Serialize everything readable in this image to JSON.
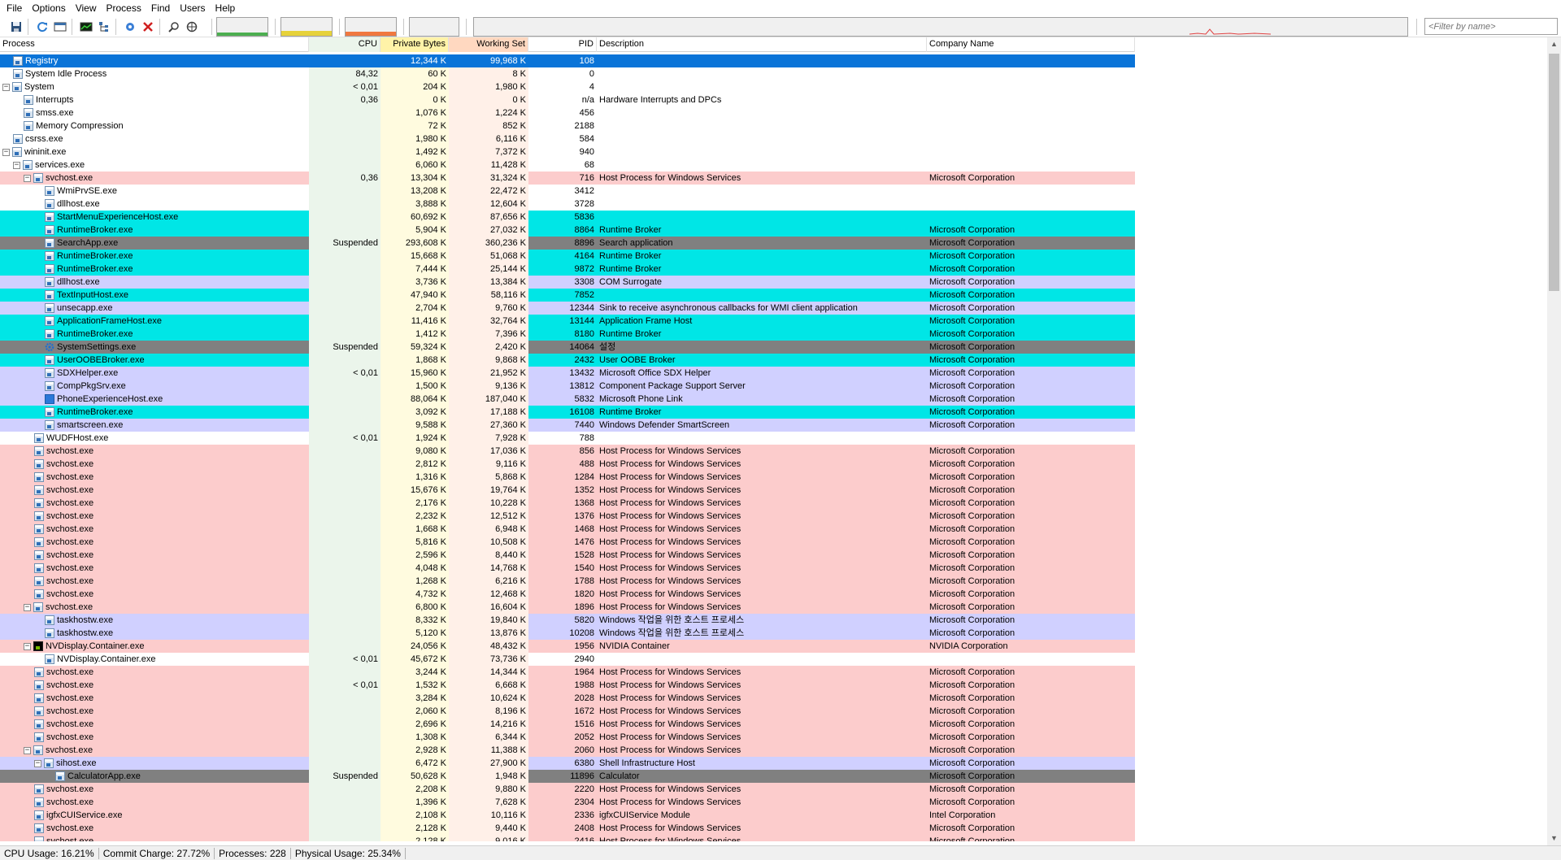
{
  "menu": [
    "File",
    "Options",
    "View",
    "Process",
    "Find",
    "Users",
    "Help"
  ],
  "toolbar": {
    "filter_placeholder": "<Filter by name>",
    "icons": [
      "save-icon",
      "refresh-icon",
      "window-icon",
      "sysinfo-icon",
      "tree-icon",
      "target-icon",
      "kill-icon",
      "find-icon",
      "crosshair-icon"
    ]
  },
  "columns": {
    "process": "Process",
    "cpu": "CPU",
    "private": "Private Bytes",
    "working": "Working Set",
    "pid": "PID",
    "description": "Description",
    "company": "Company Name"
  },
  "colors": {
    "selected": "#0a74d8",
    "services": "#fccccc",
    "own": "#d0d0ff",
    "immersive": "#00e6e6",
    "suspended": "#808080",
    "cpu_tint": "#ebf5eb",
    "private_tint": "#fffbdf",
    "working_tint": "#fff0e8"
  },
  "rows": [
    {
      "name": "Registry",
      "depth": 0,
      "toggle": "",
      "icon": "proc",
      "cpu": "",
      "priv": "12,344 K",
      "ws": "99,968 K",
      "pid": "108",
      "desc": "",
      "comp": "",
      "type": "selected"
    },
    {
      "name": "System Idle Process",
      "depth": 0,
      "toggle": "",
      "icon": "proc",
      "cpu": "84,32",
      "priv": "60 K",
      "ws": "8 K",
      "pid": "0",
      "desc": "",
      "comp": "",
      "type": "none"
    },
    {
      "name": "System",
      "depth": 0,
      "toggle": "-",
      "icon": "proc",
      "cpu": "< 0,01",
      "priv": "204 K",
      "ws": "1,980 K",
      "pid": "4",
      "desc": "",
      "comp": "",
      "type": "none"
    },
    {
      "name": "Interrupts",
      "depth": 1,
      "toggle": "",
      "icon": "proc",
      "cpu": "0,36",
      "priv": "0 K",
      "ws": "0 K",
      "pid": "n/a",
      "desc": "Hardware Interrupts and DPCs",
      "comp": "",
      "type": "none"
    },
    {
      "name": "smss.exe",
      "depth": 1,
      "toggle": "",
      "icon": "proc",
      "cpu": "",
      "priv": "1,076 K",
      "ws": "1,224 K",
      "pid": "456",
      "desc": "",
      "comp": "",
      "type": "none"
    },
    {
      "name": "Memory Compression",
      "depth": 1,
      "toggle": "",
      "icon": "proc",
      "cpu": "",
      "priv": "72 K",
      "ws": "852 K",
      "pid": "2188",
      "desc": "",
      "comp": "",
      "type": "none"
    },
    {
      "name": "csrss.exe",
      "depth": 0,
      "toggle": "",
      "icon": "proc",
      "cpu": "",
      "priv": "1,980 K",
      "ws": "6,116 K",
      "pid": "584",
      "desc": "",
      "comp": "",
      "type": "none"
    },
    {
      "name": "wininit.exe",
      "depth": 0,
      "toggle": "-",
      "icon": "proc",
      "cpu": "",
      "priv": "1,492 K",
      "ws": "7,372 K",
      "pid": "940",
      "desc": "",
      "comp": "",
      "type": "none"
    },
    {
      "name": "services.exe",
      "depth": 1,
      "toggle": "-",
      "icon": "proc",
      "cpu": "",
      "priv": "6,060 K",
      "ws": "11,428 K",
      "pid": "68",
      "desc": "",
      "comp": "",
      "type": "none"
    },
    {
      "name": "svchost.exe",
      "depth": 2,
      "toggle": "-",
      "icon": "proc",
      "cpu": "0,36",
      "priv": "13,304 K",
      "ws": "31,324 K",
      "pid": "716",
      "desc": "Host Process for Windows Services",
      "comp": "Microsoft Corporation",
      "type": "services"
    },
    {
      "name": "WmiPrvSE.exe",
      "depth": 3,
      "toggle": "",
      "icon": "proc",
      "cpu": "",
      "priv": "13,208 K",
      "ws": "22,472 K",
      "pid": "3412",
      "desc": "",
      "comp": "",
      "type": "none"
    },
    {
      "name": "dllhost.exe",
      "depth": 3,
      "toggle": "",
      "icon": "proc",
      "cpu": "",
      "priv": "3,888 K",
      "ws": "12,604 K",
      "pid": "3728",
      "desc": "",
      "comp": "",
      "type": "none"
    },
    {
      "name": "StartMenuExperienceHost.exe",
      "depth": 3,
      "toggle": "",
      "icon": "proc",
      "cpu": "",
      "priv": "60,692 K",
      "ws": "87,656 K",
      "pid": "5836",
      "desc": "",
      "comp": "",
      "type": "immersive"
    },
    {
      "name": "RuntimeBroker.exe",
      "depth": 3,
      "toggle": "",
      "icon": "proc",
      "cpu": "",
      "priv": "5,904 K",
      "ws": "27,032 K",
      "pid": "8864",
      "desc": "Runtime Broker",
      "comp": "Microsoft Corporation",
      "type": "immersive"
    },
    {
      "name": "SearchApp.exe",
      "depth": 3,
      "toggle": "",
      "icon": "proc",
      "cpu": "Suspended",
      "priv": "293,608 K",
      "ws": "360,236 K",
      "pid": "8896",
      "desc": "Search application",
      "comp": "Microsoft Corporation",
      "type": "suspended"
    },
    {
      "name": "RuntimeBroker.exe",
      "depth": 3,
      "toggle": "",
      "icon": "proc",
      "cpu": "",
      "priv": "15,668 K",
      "ws": "51,068 K",
      "pid": "4164",
      "desc": "Runtime Broker",
      "comp": "Microsoft Corporation",
      "type": "immersive"
    },
    {
      "name": "RuntimeBroker.exe",
      "depth": 3,
      "toggle": "",
      "icon": "proc",
      "cpu": "",
      "priv": "7,444 K",
      "ws": "25,144 K",
      "pid": "9872",
      "desc": "Runtime Broker",
      "comp": "Microsoft Corporation",
      "type": "immersive"
    },
    {
      "name": "dllhost.exe",
      "depth": 3,
      "toggle": "",
      "icon": "proc",
      "cpu": "",
      "priv": "3,736 K",
      "ws": "13,384 K",
      "pid": "3308",
      "desc": "COM Surrogate",
      "comp": "Microsoft Corporation",
      "type": "own"
    },
    {
      "name": "TextInputHost.exe",
      "depth": 3,
      "toggle": "",
      "icon": "proc",
      "cpu": "",
      "priv": "47,940 K",
      "ws": "58,116 K",
      "pid": "7852",
      "desc": "",
      "comp": "Microsoft Corporation",
      "type": "immersive"
    },
    {
      "name": "unsecapp.exe",
      "depth": 3,
      "toggle": "",
      "icon": "proc",
      "cpu": "",
      "priv": "2,704 K",
      "ws": "9,760 K",
      "pid": "12344",
      "desc": "Sink to receive asynchronous callbacks for WMI client application",
      "comp": "Microsoft Corporation",
      "type": "own"
    },
    {
      "name": "ApplicationFrameHost.exe",
      "depth": 3,
      "toggle": "",
      "icon": "proc",
      "cpu": "",
      "priv": "11,416 K",
      "ws": "32,764 K",
      "pid": "13144",
      "desc": "Application Frame Host",
      "comp": "Microsoft Corporation",
      "type": "immersive"
    },
    {
      "name": "RuntimeBroker.exe",
      "depth": 3,
      "toggle": "",
      "icon": "proc",
      "cpu": "",
      "priv": "1,412 K",
      "ws": "7,396 K",
      "pid": "8180",
      "desc": "Runtime Broker",
      "comp": "Microsoft Corporation",
      "type": "immersive"
    },
    {
      "name": "SystemSettings.exe",
      "depth": 3,
      "toggle": "",
      "icon": "gear",
      "cpu": "Suspended",
      "priv": "59,324 K",
      "ws": "2,420 K",
      "pid": "14064",
      "desc": "설정",
      "comp": "Microsoft Corporation",
      "type": "suspended"
    },
    {
      "name": "UserOOBEBroker.exe",
      "depth": 3,
      "toggle": "",
      "icon": "proc",
      "cpu": "",
      "priv": "1,868 K",
      "ws": "9,868 K",
      "pid": "2432",
      "desc": "User OOBE Broker",
      "comp": "Microsoft Corporation",
      "type": "immersive"
    },
    {
      "name": "SDXHelper.exe",
      "depth": 3,
      "toggle": "",
      "icon": "proc",
      "cpu": "< 0,01",
      "priv": "15,960 K",
      "ws": "21,952 K",
      "pid": "13432",
      "desc": "Microsoft Office SDX Helper",
      "comp": "Microsoft Corporation",
      "type": "own"
    },
    {
      "name": "CompPkgSrv.exe",
      "depth": 3,
      "toggle": "",
      "icon": "proc",
      "cpu": "",
      "priv": "1,500 K",
      "ws": "9,136 K",
      "pid": "13812",
      "desc": "Component Package Support Server",
      "comp": "Microsoft Corporation",
      "type": "own"
    },
    {
      "name": "PhoneExperienceHost.exe",
      "depth": 3,
      "toggle": "",
      "icon": "phone",
      "cpu": "",
      "priv": "88,064 K",
      "ws": "187,040 K",
      "pid": "5832",
      "desc": "Microsoft Phone Link",
      "comp": "Microsoft Corporation",
      "type": "own"
    },
    {
      "name": "RuntimeBroker.exe",
      "depth": 3,
      "toggle": "",
      "icon": "proc",
      "cpu": "",
      "priv": "3,092 K",
      "ws": "17,188 K",
      "pid": "16108",
      "desc": "Runtime Broker",
      "comp": "Microsoft Corporation",
      "type": "immersive"
    },
    {
      "name": "smartscreen.exe",
      "depth": 3,
      "toggle": "",
      "icon": "proc",
      "cpu": "",
      "priv": "9,588 K",
      "ws": "27,360 K",
      "pid": "7440",
      "desc": "Windows Defender SmartScreen",
      "comp": "Microsoft Corporation",
      "type": "own"
    },
    {
      "name": "WUDFHost.exe",
      "depth": 2,
      "toggle": "",
      "icon": "proc",
      "cpu": "< 0,01",
      "priv": "1,924 K",
      "ws": "7,928 K",
      "pid": "788",
      "desc": "",
      "comp": "",
      "type": "none"
    },
    {
      "name": "svchost.exe",
      "depth": 2,
      "toggle": "",
      "icon": "proc",
      "cpu": "",
      "priv": "9,080 K",
      "ws": "17,036 K",
      "pid": "856",
      "desc": "Host Process for Windows Services",
      "comp": "Microsoft Corporation",
      "type": "services"
    },
    {
      "name": "svchost.exe",
      "depth": 2,
      "toggle": "",
      "icon": "proc",
      "cpu": "",
      "priv": "2,812 K",
      "ws": "9,116 K",
      "pid": "488",
      "desc": "Host Process for Windows Services",
      "comp": "Microsoft Corporation",
      "type": "services"
    },
    {
      "name": "svchost.exe",
      "depth": 2,
      "toggle": "",
      "icon": "proc",
      "cpu": "",
      "priv": "1,316 K",
      "ws": "5,868 K",
      "pid": "1284",
      "desc": "Host Process for Windows Services",
      "comp": "Microsoft Corporation",
      "type": "services"
    },
    {
      "name": "svchost.exe",
      "depth": 2,
      "toggle": "",
      "icon": "proc",
      "cpu": "",
      "priv": "15,676 K",
      "ws": "19,764 K",
      "pid": "1352",
      "desc": "Host Process for Windows Services",
      "comp": "Microsoft Corporation",
      "type": "services"
    },
    {
      "name": "svchost.exe",
      "depth": 2,
      "toggle": "",
      "icon": "proc",
      "cpu": "",
      "priv": "2,176 K",
      "ws": "10,228 K",
      "pid": "1368",
      "desc": "Host Process for Windows Services",
      "comp": "Microsoft Corporation",
      "type": "services"
    },
    {
      "name": "svchost.exe",
      "depth": 2,
      "toggle": "",
      "icon": "proc",
      "cpu": "",
      "priv": "2,232 K",
      "ws": "12,512 K",
      "pid": "1376",
      "desc": "Host Process for Windows Services",
      "comp": "Microsoft Corporation",
      "type": "services"
    },
    {
      "name": "svchost.exe",
      "depth": 2,
      "toggle": "",
      "icon": "proc",
      "cpu": "",
      "priv": "1,668 K",
      "ws": "6,948 K",
      "pid": "1468",
      "desc": "Host Process for Windows Services",
      "comp": "Microsoft Corporation",
      "type": "services"
    },
    {
      "name": "svchost.exe",
      "depth": 2,
      "toggle": "",
      "icon": "proc",
      "cpu": "",
      "priv": "5,816 K",
      "ws": "10,508 K",
      "pid": "1476",
      "desc": "Host Process for Windows Services",
      "comp": "Microsoft Corporation",
      "type": "services"
    },
    {
      "name": "svchost.exe",
      "depth": 2,
      "toggle": "",
      "icon": "proc",
      "cpu": "",
      "priv": "2,596 K",
      "ws": "8,440 K",
      "pid": "1528",
      "desc": "Host Process for Windows Services",
      "comp": "Microsoft Corporation",
      "type": "services"
    },
    {
      "name": "svchost.exe",
      "depth": 2,
      "toggle": "",
      "icon": "proc",
      "cpu": "",
      "priv": "4,048 K",
      "ws": "14,768 K",
      "pid": "1540",
      "desc": "Host Process for Windows Services",
      "comp": "Microsoft Corporation",
      "type": "services"
    },
    {
      "name": "svchost.exe",
      "depth": 2,
      "toggle": "",
      "icon": "proc",
      "cpu": "",
      "priv": "1,268 K",
      "ws": "6,216 K",
      "pid": "1788",
      "desc": "Host Process for Windows Services",
      "comp": "Microsoft Corporation",
      "type": "services"
    },
    {
      "name": "svchost.exe",
      "depth": 2,
      "toggle": "",
      "icon": "proc",
      "cpu": "",
      "priv": "4,732 K",
      "ws": "12,468 K",
      "pid": "1820",
      "desc": "Host Process for Windows Services",
      "comp": "Microsoft Corporation",
      "type": "services"
    },
    {
      "name": "svchost.exe",
      "depth": 2,
      "toggle": "-",
      "icon": "proc",
      "cpu": "",
      "priv": "6,800 K",
      "ws": "16,604 K",
      "pid": "1896",
      "desc": "Host Process for Windows Services",
      "comp": "Microsoft Corporation",
      "type": "services"
    },
    {
      "name": "taskhostw.exe",
      "depth": 3,
      "toggle": "",
      "icon": "proc",
      "cpu": "",
      "priv": "8,332 K",
      "ws": "19,840 K",
      "pid": "5820",
      "desc": "Windows 작업을 위한 호스트 프로세스",
      "comp": "Microsoft Corporation",
      "type": "own"
    },
    {
      "name": "taskhostw.exe",
      "depth": 3,
      "toggle": "",
      "icon": "proc",
      "cpu": "",
      "priv": "5,120 K",
      "ws": "13,876 K",
      "pid": "10208",
      "desc": "Windows 작업을 위한 호스트 프로세스",
      "comp": "Microsoft Corporation",
      "type": "own"
    },
    {
      "name": "NVDisplay.Container.exe",
      "depth": 2,
      "toggle": "-",
      "icon": "nv",
      "cpu": "",
      "priv": "24,056 K",
      "ws": "48,432 K",
      "pid": "1956",
      "desc": "NVIDIA Container",
      "comp": "NVIDIA Corporation",
      "type": "services"
    },
    {
      "name": "NVDisplay.Container.exe",
      "depth": 3,
      "toggle": "",
      "icon": "proc",
      "cpu": "< 0,01",
      "priv": "45,672 K",
      "ws": "73,736 K",
      "pid": "2940",
      "desc": "",
      "comp": "",
      "type": "none"
    },
    {
      "name": "svchost.exe",
      "depth": 2,
      "toggle": "",
      "icon": "proc",
      "cpu": "",
      "priv": "3,244 K",
      "ws": "14,344 K",
      "pid": "1964",
      "desc": "Host Process for Windows Services",
      "comp": "Microsoft Corporation",
      "type": "services"
    },
    {
      "name": "svchost.exe",
      "depth": 2,
      "toggle": "",
      "icon": "proc",
      "cpu": "< 0,01",
      "priv": "1,532 K",
      "ws": "6,668 K",
      "pid": "1988",
      "desc": "Host Process for Windows Services",
      "comp": "Microsoft Corporation",
      "type": "services"
    },
    {
      "name": "svchost.exe",
      "depth": 2,
      "toggle": "",
      "icon": "proc",
      "cpu": "",
      "priv": "3,284 K",
      "ws": "10,624 K",
      "pid": "2028",
      "desc": "Host Process for Windows Services",
      "comp": "Microsoft Corporation",
      "type": "services"
    },
    {
      "name": "svchost.exe",
      "depth": 2,
      "toggle": "",
      "icon": "proc",
      "cpu": "",
      "priv": "2,060 K",
      "ws": "8,196 K",
      "pid": "1672",
      "desc": "Host Process for Windows Services",
      "comp": "Microsoft Corporation",
      "type": "services"
    },
    {
      "name": "svchost.exe",
      "depth": 2,
      "toggle": "",
      "icon": "proc",
      "cpu": "",
      "priv": "2,696 K",
      "ws": "14,216 K",
      "pid": "1516",
      "desc": "Host Process for Windows Services",
      "comp": "Microsoft Corporation",
      "type": "services"
    },
    {
      "name": "svchost.exe",
      "depth": 2,
      "toggle": "",
      "icon": "proc",
      "cpu": "",
      "priv": "1,308 K",
      "ws": "6,344 K",
      "pid": "2052",
      "desc": "Host Process for Windows Services",
      "comp": "Microsoft Corporation",
      "type": "services"
    },
    {
      "name": "svchost.exe",
      "depth": 2,
      "toggle": "-",
      "icon": "proc",
      "cpu": "",
      "priv": "2,928 K",
      "ws": "11,388 K",
      "pid": "2060",
      "desc": "Host Process for Windows Services",
      "comp": "Microsoft Corporation",
      "type": "services"
    },
    {
      "name": "sihost.exe",
      "depth": 3,
      "toggle": "-",
      "icon": "proc",
      "cpu": "",
      "priv": "6,472 K",
      "ws": "27,900 K",
      "pid": "6380",
      "desc": "Shell Infrastructure Host",
      "comp": "Microsoft Corporation",
      "type": "own"
    },
    {
      "name": "CalculatorApp.exe",
      "depth": 4,
      "toggle": "",
      "icon": "proc",
      "cpu": "Suspended",
      "priv": "50,628 K",
      "ws": "1,948 K",
      "pid": "11896",
      "desc": "Calculator",
      "comp": "Microsoft Corporation",
      "type": "suspended"
    },
    {
      "name": "svchost.exe",
      "depth": 2,
      "toggle": "",
      "icon": "proc",
      "cpu": "",
      "priv": "2,208 K",
      "ws": "9,880 K",
      "pid": "2220",
      "desc": "Host Process for Windows Services",
      "comp": "Microsoft Corporation",
      "type": "services"
    },
    {
      "name": "svchost.exe",
      "depth": 2,
      "toggle": "",
      "icon": "proc",
      "cpu": "",
      "priv": "1,396 K",
      "ws": "7,628 K",
      "pid": "2304",
      "desc": "Host Process for Windows Services",
      "comp": "Microsoft Corporation",
      "type": "services"
    },
    {
      "name": "igfxCUIService.exe",
      "depth": 2,
      "toggle": "",
      "icon": "proc",
      "cpu": "",
      "priv": "2,108 K",
      "ws": "10,116 K",
      "pid": "2336",
      "desc": "igfxCUIService Module",
      "comp": "Intel Corporation",
      "type": "services"
    },
    {
      "name": "svchost.exe",
      "depth": 2,
      "toggle": "",
      "icon": "proc",
      "cpu": "",
      "priv": "2,128 K",
      "ws": "9,440 K",
      "pid": "2408",
      "desc": "Host Process for Windows Services",
      "comp": "Microsoft Corporation",
      "type": "services"
    },
    {
      "name": "svchost.exe",
      "depth": 2,
      "toggle": "",
      "icon": "proc",
      "cpu": "",
      "priv": "2,128 K",
      "ws": "9,016 K",
      "pid": "2416",
      "desc": "Host Process for Windows Services",
      "comp": "Microsoft Corporation",
      "type": "services"
    }
  ],
  "status": {
    "cpu": "CPU Usage: 16.21%",
    "commit": "Commit Charge: 27.72%",
    "processes": "Processes: 228",
    "physical": "Physical Usage: 25.34%"
  },
  "graphs": {
    "cpu_usage": 0.16,
    "commit_charge": 0.28,
    "physical_usage": 0.25
  }
}
